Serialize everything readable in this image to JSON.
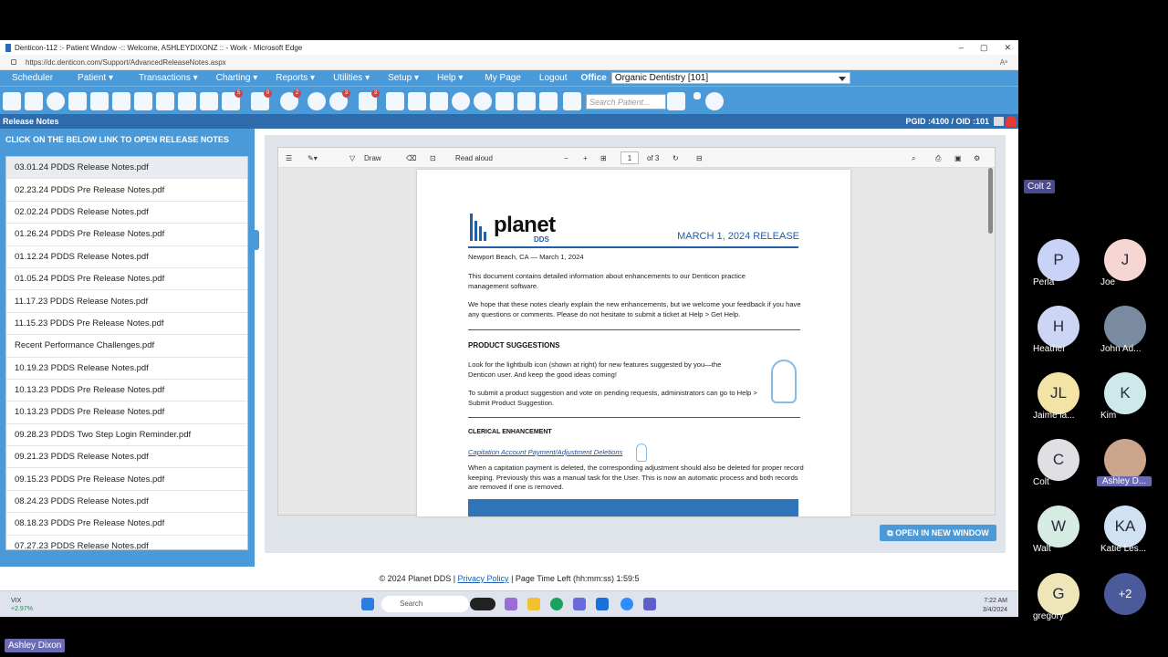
{
  "browser": {
    "title": "Denticon-112 :- Patient Window -:: Welcome, ASHLEYDIXONZ :: - Work - Microsoft Edge",
    "url": "https://dc.denticon.com/Support/AdvancedReleaseNotes.aspx",
    "controls": [
      "–",
      "▢",
      "✕"
    ],
    "reader_label": "Aᵃ"
  },
  "menu": {
    "items": [
      "Scheduler",
      "Patient ▾",
      "Transactions ▾",
      "Charting ▾",
      "Reports ▾",
      "Utilities ▾",
      "Setup ▾",
      "Help ▾",
      "My Page",
      "Logout"
    ],
    "office_label": "Office",
    "office_value": "Organic Dentistry [101]"
  },
  "toolbar": {
    "search_placeholder": "Search Patient...",
    "badges": [
      "5",
      "0",
      "2",
      "3",
      "3"
    ]
  },
  "subbar": {
    "title": "Release Notes",
    "ids": "PGID :4100  /  OID :101"
  },
  "sidebar": {
    "header": "CLICK ON THE BELOW LINK TO OPEN RELEASE NOTES",
    "files": [
      "03.01.24 PDDS Release Notes.pdf",
      "02.23.24 PDDS Pre Release Notes.pdf",
      "02.02.24 PDDS Release Notes.pdf",
      "01.26.24 PDDS Pre Release Notes.pdf",
      "01.12.24 PDDS Release Notes.pdf",
      "01.05.24 PDDS Pre Release Notes.pdf",
      "11.17.23 PDDS Release Notes.pdf",
      "11.15.23 PDDS Pre Release Notes.pdf",
      "Recent Performance Challenges.pdf",
      "10.19.23 PDDS Release Notes.pdf",
      "10.13.23 PDDS Pre Release Notes.pdf",
      "10.13.23 PDDS Pre Release Notes.pdf",
      "09.28.23 PDDS Two Step Login Reminder.pdf",
      "09.21.23 PDDS Release Notes.pdf",
      "09.15.23 PDDS Pre Release Notes.pdf",
      "08.24.23 PDDS Release Notes.pdf",
      "08.18.23 PDDS Pre Release Notes.pdf",
      "07.27.23 PDDS Release Notes.pdf"
    ]
  },
  "pdf_toolbar": {
    "draw": "Draw",
    "read_aloud": "Read aloud",
    "minus": "−",
    "plus": "+",
    "page": "1",
    "of": "of 3"
  },
  "pdf": {
    "logo_name": "planet",
    "logo_sub": "DDS",
    "release": "MARCH 1, 2024 RELEASE",
    "dateline": "Newport Beach, CA — March 1, 2024",
    "intro1": "This document contains detailed information about enhancements to our Denticon practice management software.",
    "intro2": "We hope that these notes clearly explain the new enhancements, but we welcome your feedback if you have any questions or comments. Please do not hesitate to submit a ticket at Help > Get Help.",
    "h1": "PRODUCT SUGGESTIONS",
    "p1": "Look for the lightbulb icon (shown at right) for new features suggested by you—the Denticon user. And keep the good ideas coming!",
    "p2": "To submit a product suggestion and vote on pending requests, administrators can go to Help > Submit Product Suggestion.",
    "h2": "CLERICAL ENHANCEMENT",
    "sub": "Capitation Account Payment/Adjustment Deletions",
    "p3": "When a capitation payment is deleted, the corresponding adjustment should also be deleted for proper record keeping. Previously this was a manual task for the User. This is now an automatic process and both records are removed if one is removed."
  },
  "open_button": "⧉ OPEN IN NEW WINDOW",
  "footer": {
    "copyright": "© 2024 Planet DDS |",
    "privacy": "Privacy Policy",
    "time_left": "| Page Time Left (hh:mm:ss) 1:59:5"
  },
  "taskbar": {
    "ticker": "VIX",
    "change": "+2.97%",
    "search": "Search",
    "time": "7:22 AM",
    "date": "3/4/2024"
  },
  "meeting": {
    "presenter": "Ashley Dixon",
    "colt2": "Colt 2",
    "participants": [
      {
        "initials": "P",
        "name": "Perla",
        "color": "#c9d3f7"
      },
      {
        "initials": "J",
        "name": "Joe",
        "color": "#f6d6d2"
      },
      {
        "initials": "H",
        "name": "Heather",
        "color": "#cdd5f5"
      },
      {
        "initials": "",
        "name": "John Ad...",
        "color": "#7a8aa0"
      },
      {
        "initials": "JL",
        "name": "Jaime la...",
        "color": "#f3e3a4"
      },
      {
        "initials": "K",
        "name": "Kim",
        "color": "#cde9ec"
      },
      {
        "initials": "C",
        "name": "Colt",
        "color": "#e0e0e4"
      },
      {
        "initials": "",
        "name": "Ashley D...",
        "color": "#caa58c"
      },
      {
        "initials": "W",
        "name": "Walt",
        "color": "#d6ebe2"
      },
      {
        "initials": "KA",
        "name": "Katie Les...",
        "color": "#cfe1f2"
      },
      {
        "initials": "G",
        "name": "gregory",
        "color": "#eee6b8"
      },
      {
        "initials": "+2",
        "name": "",
        "color": "#4a5a9a"
      }
    ]
  }
}
